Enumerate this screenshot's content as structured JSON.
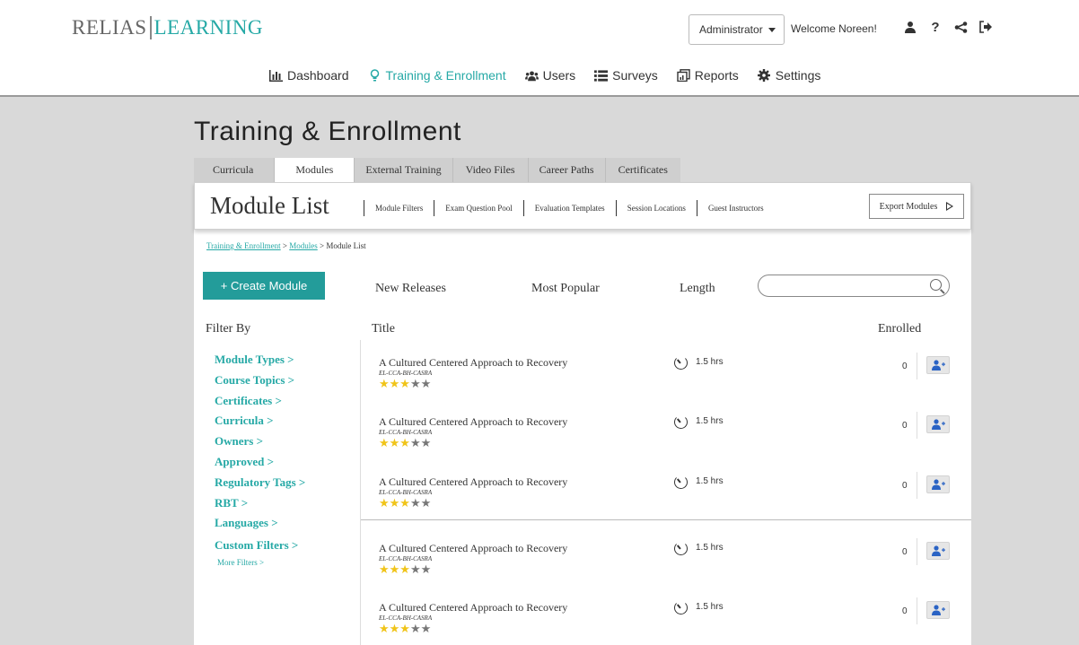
{
  "logo": {
    "left": "RELIAS",
    "right": "LEARNING"
  },
  "header": {
    "role": "Administrator",
    "welcome": "Welcome Noreen!",
    "icons": [
      "user-icon",
      "help-icon",
      "share-icon",
      "logout-icon"
    ]
  },
  "nav": [
    {
      "label": "Dashboard",
      "icon": "bar-chart-icon"
    },
    {
      "label": "Training & Enrollment",
      "icon": "lightbulb-icon",
      "active": true
    },
    {
      "label": "Users",
      "icon": "users-icon"
    },
    {
      "label": "Surveys",
      "icon": "list-icon"
    },
    {
      "label": "Reports",
      "icon": "reports-icon"
    },
    {
      "label": "Settings",
      "icon": "gear-icon"
    }
  ],
  "page_title": "Training & Enrollment",
  "tabs": [
    "Curricula",
    "Modules",
    "External Training",
    "Video Files",
    "Career Paths",
    "Certificates"
  ],
  "active_tab": "Modules",
  "subbar": {
    "title": "Module List",
    "links": [
      "Module Filters",
      "Exam Question Pool",
      "Evaluation Templates",
      "Session Locations",
      "Guest Instructors"
    ],
    "export": "Export Modules"
  },
  "breadcrumb": {
    "item1": "Training & Enrollment",
    "sep": " > ",
    "item2": "Modules",
    "current": "Module List"
  },
  "create_button": "+ Create Module",
  "sort_options": [
    "New Releases",
    "Most Popular",
    "Length"
  ],
  "search": {
    "placeholder": ""
  },
  "columns": {
    "filter": "Filter By",
    "title": "Title",
    "enrolled": "Enrolled"
  },
  "filters": [
    "Module Types >",
    "Course Topics >",
    "Certificates >",
    "Curricula >",
    "Owners >",
    "Approved >",
    "Regulatory Tags >",
    "RBT >",
    "Languages >",
    "Custom Filters >"
  ],
  "more_filters": "More Filters >",
  "modules": [
    {
      "title": "A Cultured Centered Approach to Recovery",
      "code": "EL-CCA-BH-CASRA",
      "rating": 3,
      "length": "1.5 hrs",
      "enrolled": "0"
    },
    {
      "title": "A Cultured Centered Approach to Recovery",
      "code": "EL-CCA-BH-CASRA",
      "rating": 3,
      "length": "1.5 hrs",
      "enrolled": "0"
    },
    {
      "title": "A Cultured Centered Approach to Recovery",
      "code": "EL-CCA-BH-CASRA",
      "rating": 3,
      "length": "1.5 hrs",
      "enrolled": "0"
    },
    {
      "title": "A Cultured Centered Approach to Recovery",
      "code": "EL-CCA-BH-CASRA",
      "rating": 3,
      "length": "1.5 hrs",
      "enrolled": "0"
    },
    {
      "title": "A Cultured Centered Approach to Recovery",
      "code": "EL-CCA-BH-CASRA",
      "rating": 3,
      "length": "1.5 hrs",
      "enrolled": "0"
    }
  ],
  "colors": {
    "accent": "#26a9a6",
    "button": "#239c9a",
    "star": "#f0c419"
  }
}
